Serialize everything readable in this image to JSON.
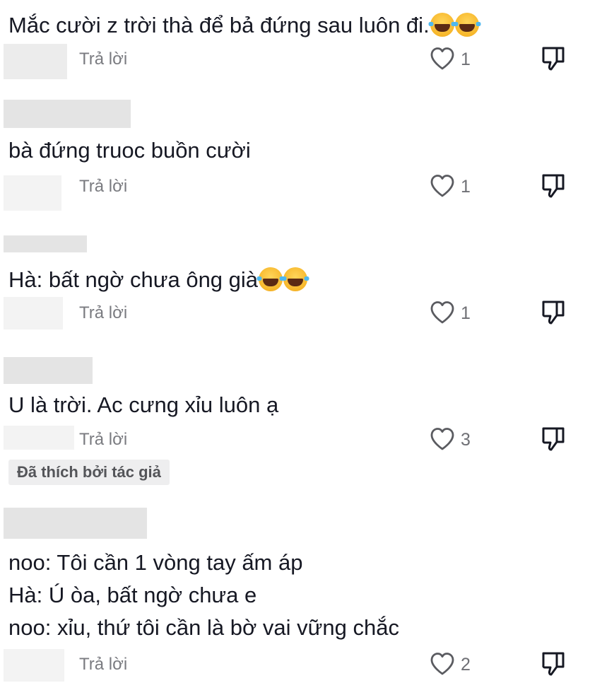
{
  "comments": [
    {
      "text": "Mắc cười z trời thà để bả đứng sau luôn đi.",
      "emojis": [
        "laugh-cry-emoji",
        "laugh-cry-emoji"
      ],
      "reply_label": "Trả lời",
      "likes": "1"
    },
    {
      "text": "bà đứng truoc buồn cười",
      "emojis": [],
      "reply_label": "Trả lời",
      "likes": "1"
    },
    {
      "text": "Hà: bất ngờ chưa ông già",
      "emojis": [
        "laugh-cry-emoji",
        "laugh-cry-emoji"
      ],
      "reply_label": "Trả lời",
      "likes": "1"
    },
    {
      "text": "U là trời. Ac cưng xỉu luôn ạ",
      "emojis": [],
      "reply_label": "Trả lời",
      "likes": "3",
      "badge": "Đã thích bởi tác giả"
    },
    {
      "lines": [
        "noo: Tôi cần 1 vòng tay ấm áp",
        "Hà: Ú òa, bất ngờ chưa e",
        "noo: xỉu, thứ tôi cần là bờ vai vững chắc"
      ],
      "reply_label": "Trả lời",
      "likes": "2"
    }
  ],
  "icons": {
    "like": "heart-outline-icon",
    "dislike": "thumbs-down-icon"
  },
  "colors": {
    "text": "#161823",
    "secondary": "#7a7b80",
    "badge_bg": "#eeeeef"
  }
}
